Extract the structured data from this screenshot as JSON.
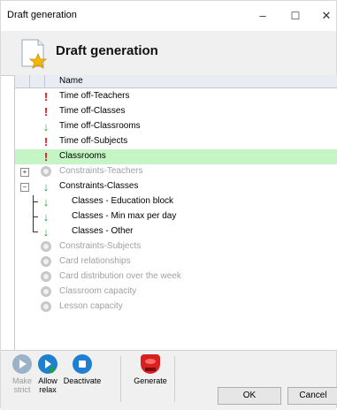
{
  "window": {
    "title": "Draft generation",
    "controls": {
      "minimize": "–",
      "maximize": "☐",
      "close": "✕"
    }
  },
  "header": {
    "title": "Draft generation",
    "icon": "document-star-icon"
  },
  "grid": {
    "column_name": "Name",
    "rows": [
      {
        "label": "Time off-Teachers",
        "status": "error"
      },
      {
        "label": "Time off-Classes",
        "status": "error"
      },
      {
        "label": "Time off-Classrooms",
        "status": "ok"
      },
      {
        "label": "Time off-Subjects",
        "status": "error"
      },
      {
        "label": "Classrooms",
        "status": "error",
        "highlighted": true
      },
      {
        "label": "Constraints-Teachers",
        "status": "inactive",
        "expander": "+"
      },
      {
        "label": "Constraints-Classes",
        "status": "ok",
        "expander": "−"
      },
      {
        "label": "Classes - Education block",
        "status": "ok",
        "child": true
      },
      {
        "label": "Classes - Min max per day",
        "status": "ok",
        "child": true
      },
      {
        "label": "Classes - Other",
        "status": "ok",
        "child": true
      },
      {
        "label": "Constraints-Subjects",
        "status": "inactive"
      },
      {
        "label": "Card relationships",
        "status": "inactive"
      },
      {
        "label": "Card distribution over the week",
        "status": "inactive"
      },
      {
        "label": "Classroom capacity",
        "status": "inactive"
      },
      {
        "label": "Lesson capacity",
        "status": "inactive"
      }
    ]
  },
  "toolbar": {
    "make_strict_line1": "Make",
    "make_strict_line2": "strict",
    "allow_relax_line1": "Allow",
    "allow_relax_line2": "relax",
    "deactivate": "Deactivate",
    "generate": "Generate"
  },
  "buttons": {
    "ok": "OK",
    "cancel": "Cancel"
  },
  "colors": {
    "error": "#e01010",
    "ok": "#1aa62a",
    "highlight": "#c5f5c5",
    "accent_blue": "#1f7fd0"
  }
}
